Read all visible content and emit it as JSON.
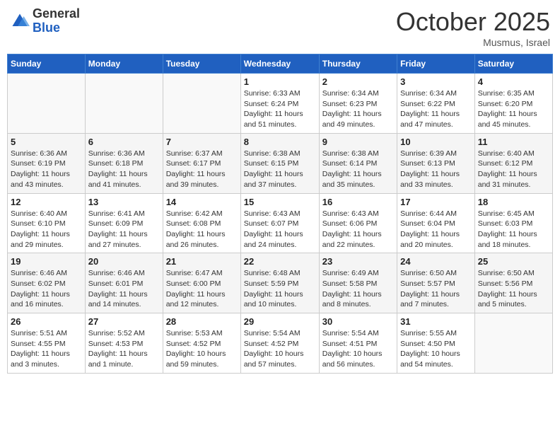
{
  "header": {
    "logo_general": "General",
    "logo_blue": "Blue",
    "month_title": "October 2025",
    "location": "Musmus, Israel"
  },
  "days_of_week": [
    "Sunday",
    "Monday",
    "Tuesday",
    "Wednesday",
    "Thursday",
    "Friday",
    "Saturday"
  ],
  "weeks": [
    [
      {
        "day": "",
        "info": ""
      },
      {
        "day": "",
        "info": ""
      },
      {
        "day": "",
        "info": ""
      },
      {
        "day": "1",
        "info": "Sunrise: 6:33 AM\nSunset: 6:24 PM\nDaylight: 11 hours\nand 51 minutes."
      },
      {
        "day": "2",
        "info": "Sunrise: 6:34 AM\nSunset: 6:23 PM\nDaylight: 11 hours\nand 49 minutes."
      },
      {
        "day": "3",
        "info": "Sunrise: 6:34 AM\nSunset: 6:22 PM\nDaylight: 11 hours\nand 47 minutes."
      },
      {
        "day": "4",
        "info": "Sunrise: 6:35 AM\nSunset: 6:20 PM\nDaylight: 11 hours\nand 45 minutes."
      }
    ],
    [
      {
        "day": "5",
        "info": "Sunrise: 6:36 AM\nSunset: 6:19 PM\nDaylight: 11 hours\nand 43 minutes."
      },
      {
        "day": "6",
        "info": "Sunrise: 6:36 AM\nSunset: 6:18 PM\nDaylight: 11 hours\nand 41 minutes."
      },
      {
        "day": "7",
        "info": "Sunrise: 6:37 AM\nSunset: 6:17 PM\nDaylight: 11 hours\nand 39 minutes."
      },
      {
        "day": "8",
        "info": "Sunrise: 6:38 AM\nSunset: 6:15 PM\nDaylight: 11 hours\nand 37 minutes."
      },
      {
        "day": "9",
        "info": "Sunrise: 6:38 AM\nSunset: 6:14 PM\nDaylight: 11 hours\nand 35 minutes."
      },
      {
        "day": "10",
        "info": "Sunrise: 6:39 AM\nSunset: 6:13 PM\nDaylight: 11 hours\nand 33 minutes."
      },
      {
        "day": "11",
        "info": "Sunrise: 6:40 AM\nSunset: 6:12 PM\nDaylight: 11 hours\nand 31 minutes."
      }
    ],
    [
      {
        "day": "12",
        "info": "Sunrise: 6:40 AM\nSunset: 6:10 PM\nDaylight: 11 hours\nand 29 minutes."
      },
      {
        "day": "13",
        "info": "Sunrise: 6:41 AM\nSunset: 6:09 PM\nDaylight: 11 hours\nand 27 minutes."
      },
      {
        "day": "14",
        "info": "Sunrise: 6:42 AM\nSunset: 6:08 PM\nDaylight: 11 hours\nand 26 minutes."
      },
      {
        "day": "15",
        "info": "Sunrise: 6:43 AM\nSunset: 6:07 PM\nDaylight: 11 hours\nand 24 minutes."
      },
      {
        "day": "16",
        "info": "Sunrise: 6:43 AM\nSunset: 6:06 PM\nDaylight: 11 hours\nand 22 minutes."
      },
      {
        "day": "17",
        "info": "Sunrise: 6:44 AM\nSunset: 6:04 PM\nDaylight: 11 hours\nand 20 minutes."
      },
      {
        "day": "18",
        "info": "Sunrise: 6:45 AM\nSunset: 6:03 PM\nDaylight: 11 hours\nand 18 minutes."
      }
    ],
    [
      {
        "day": "19",
        "info": "Sunrise: 6:46 AM\nSunset: 6:02 PM\nDaylight: 11 hours\nand 16 minutes."
      },
      {
        "day": "20",
        "info": "Sunrise: 6:46 AM\nSunset: 6:01 PM\nDaylight: 11 hours\nand 14 minutes."
      },
      {
        "day": "21",
        "info": "Sunrise: 6:47 AM\nSunset: 6:00 PM\nDaylight: 11 hours\nand 12 minutes."
      },
      {
        "day": "22",
        "info": "Sunrise: 6:48 AM\nSunset: 5:59 PM\nDaylight: 11 hours\nand 10 minutes."
      },
      {
        "day": "23",
        "info": "Sunrise: 6:49 AM\nSunset: 5:58 PM\nDaylight: 11 hours\nand 8 minutes."
      },
      {
        "day": "24",
        "info": "Sunrise: 6:50 AM\nSunset: 5:57 PM\nDaylight: 11 hours\nand 7 minutes."
      },
      {
        "day": "25",
        "info": "Sunrise: 6:50 AM\nSunset: 5:56 PM\nDaylight: 11 hours\nand 5 minutes."
      }
    ],
    [
      {
        "day": "26",
        "info": "Sunrise: 5:51 AM\nSunset: 4:55 PM\nDaylight: 11 hours\nand 3 minutes."
      },
      {
        "day": "27",
        "info": "Sunrise: 5:52 AM\nSunset: 4:53 PM\nDaylight: 11 hours\nand 1 minute."
      },
      {
        "day": "28",
        "info": "Sunrise: 5:53 AM\nSunset: 4:52 PM\nDaylight: 10 hours\nand 59 minutes."
      },
      {
        "day": "29",
        "info": "Sunrise: 5:54 AM\nSunset: 4:52 PM\nDaylight: 10 hours\nand 57 minutes."
      },
      {
        "day": "30",
        "info": "Sunrise: 5:54 AM\nSunset: 4:51 PM\nDaylight: 10 hours\nand 56 minutes."
      },
      {
        "day": "31",
        "info": "Sunrise: 5:55 AM\nSunset: 4:50 PM\nDaylight: 10 hours\nand 54 minutes."
      },
      {
        "day": "",
        "info": ""
      }
    ]
  ]
}
